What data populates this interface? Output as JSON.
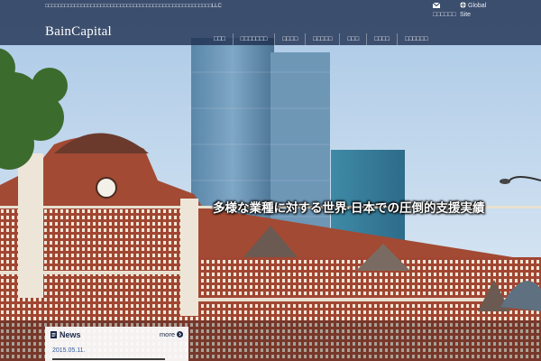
{
  "header": {
    "tagline": "□□□□□□□□□□□□□□□□□□□□□□□□□□□□□□□□□□□□□□□□□□□□□□□□□□□LLC",
    "logo": "BainCapital",
    "utility": [
      {
        "label": "□□□□□□",
        "icon": "envelope-icon"
      },
      {
        "label": "Global Site",
        "icon": "globe-icon"
      }
    ],
    "nav": [
      "□□□",
      "□□□□□□□",
      "□□□□",
      "□□□□□",
      "□□□",
      "□□□□",
      "□□□□□□"
    ]
  },
  "hero": {
    "headline": "多様な業種に対する世界·日本での圧倒的支援実績"
  },
  "news": {
    "title": "News",
    "more_label": "more",
    "items": [
      {
        "date": "2015.05.11."
      }
    ]
  },
  "colors": {
    "header_bg": "#1c2c4c",
    "accent": "#1b2a48",
    "date_link": "#2e5a9a"
  }
}
